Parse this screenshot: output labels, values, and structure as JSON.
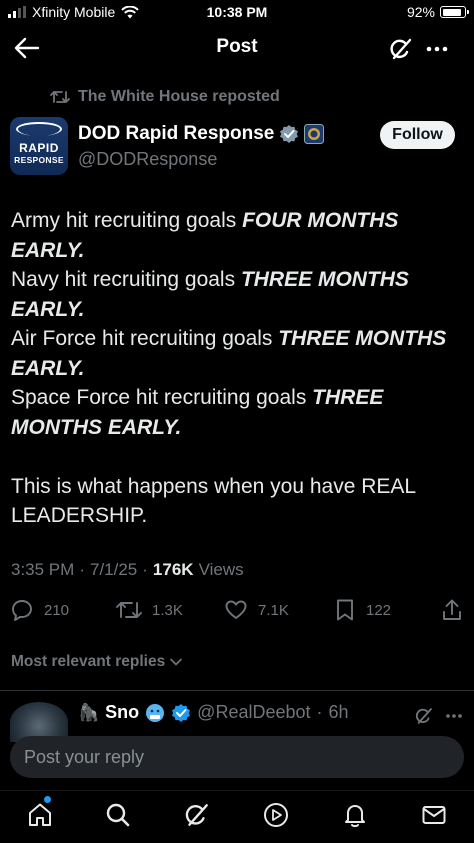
{
  "status_bar": {
    "carrier": "Xfinity Mobile",
    "time": "10:38 PM",
    "battery": "92%",
    "battery_level": 0.92
  },
  "header": {
    "title": "Post"
  },
  "repost": {
    "text": "The White House reposted"
  },
  "author": {
    "avatar_line1": "RAPID",
    "avatar_line2": "RESPONSE",
    "name": "DOD Rapid Response",
    "handle": "@DODResponse",
    "follow_label": "Follow"
  },
  "post": {
    "lines": [
      {
        "plain": "Army hit recruiting goals ",
        "bold": "FOUR MONTHS EARLY."
      },
      {
        "plain": "Navy hit recruiting goals ",
        "bold": "THREE MONTHS EARLY."
      },
      {
        "plain": "Air Force hit recruiting goals ",
        "bold": "THREE MONTHS EARLY."
      },
      {
        "plain": "Space Force hit recruiting goals ",
        "bold": "THREE MONTHS EARLY."
      }
    ],
    "closing": "This is what happens when you have REAL LEADERSHIP."
  },
  "meta": {
    "time": "3:35 PM",
    "date": "7/1/25",
    "views_count": "176K",
    "views_label": "Views"
  },
  "actions": {
    "replies": "210",
    "reposts": "1.3K",
    "likes": "7.1K",
    "bookmarks": "122"
  },
  "replies_filter": {
    "label": "Most relevant replies"
  },
  "reply_preview": {
    "name": "Sno",
    "handle": "@RealDeebot",
    "age": "6h"
  },
  "reply_input": {
    "placeholder": "Post your reply"
  },
  "colors": {
    "background": "#000000",
    "text": "#e7e9ea",
    "secondary": "#71767b",
    "accent": "#1d9bf0",
    "verified_badge": "#1d9bf0"
  },
  "icons": {
    "back": "arrow-left-icon",
    "grok": "grok-icon",
    "more": "more-icon",
    "repost": "repost-icon",
    "reply": "reply-icon",
    "like": "heart-icon",
    "bookmark": "bookmark-icon",
    "share": "share-icon",
    "home": "home-icon",
    "search": "search-icon",
    "media": "play-icon",
    "notifications": "bell-icon",
    "messages": "mail-icon"
  }
}
